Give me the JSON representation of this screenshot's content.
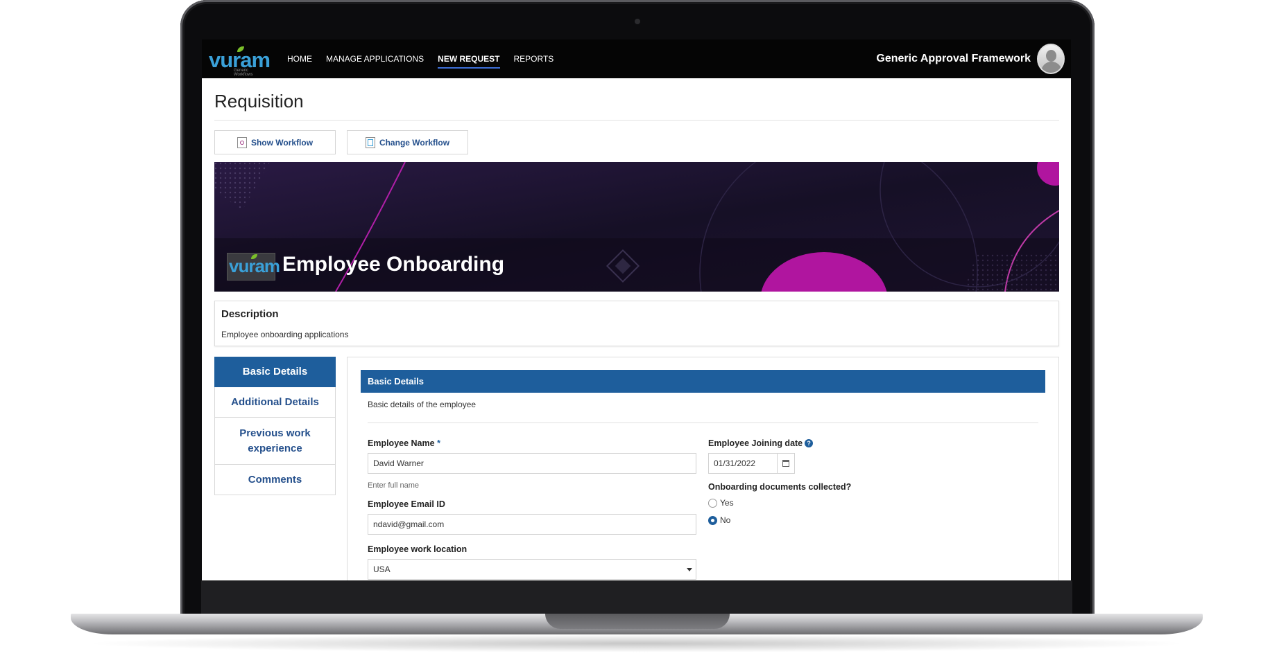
{
  "topbar": {
    "logo_text": "vuram",
    "logo_sub": "Generic Workflows",
    "nav": [
      {
        "label": "HOME",
        "active": false
      },
      {
        "label": "MANAGE APPLICATIONS",
        "active": false
      },
      {
        "label": "NEW REQUEST",
        "active": true
      },
      {
        "label": "REPORTS",
        "active": false
      }
    ],
    "app_title": "Generic Approval Framework"
  },
  "page": {
    "title": "Requisition",
    "show_workflow_label": "Show Workflow",
    "change_workflow_label": "Change Workflow"
  },
  "banner": {
    "logo_text": "vuram",
    "title": "Employee Onboarding"
  },
  "description": {
    "label": "Description",
    "text": "Employee onboarding applications"
  },
  "side_tabs": [
    {
      "label": "Basic Details",
      "active": true
    },
    {
      "label": "Additional Details",
      "active": false
    },
    {
      "label": "Previous work experience",
      "active": false
    },
    {
      "label": "Comments",
      "active": false
    }
  ],
  "form": {
    "section_title": "Basic Details",
    "section_subtitle": "Basic details of the employee",
    "employee_name": {
      "label": "Employee Name",
      "required_mark": "*",
      "value": "David Warner",
      "hint": "Enter full name"
    },
    "employee_email": {
      "label": "Employee Email ID",
      "value": "ndavid@gmail.com"
    },
    "work_location": {
      "label": "Employee work location",
      "value": "USA"
    },
    "joining_date": {
      "label": "Employee Joining date",
      "help": "?",
      "value": "01/31/2022"
    },
    "documents": {
      "label": "Onboarding documents collected?",
      "options": [
        "Yes",
        "No"
      ],
      "selected": "No"
    }
  },
  "colors": {
    "accent": "#1e5e9c",
    "link": "#25508c",
    "topbar": "#050505"
  }
}
